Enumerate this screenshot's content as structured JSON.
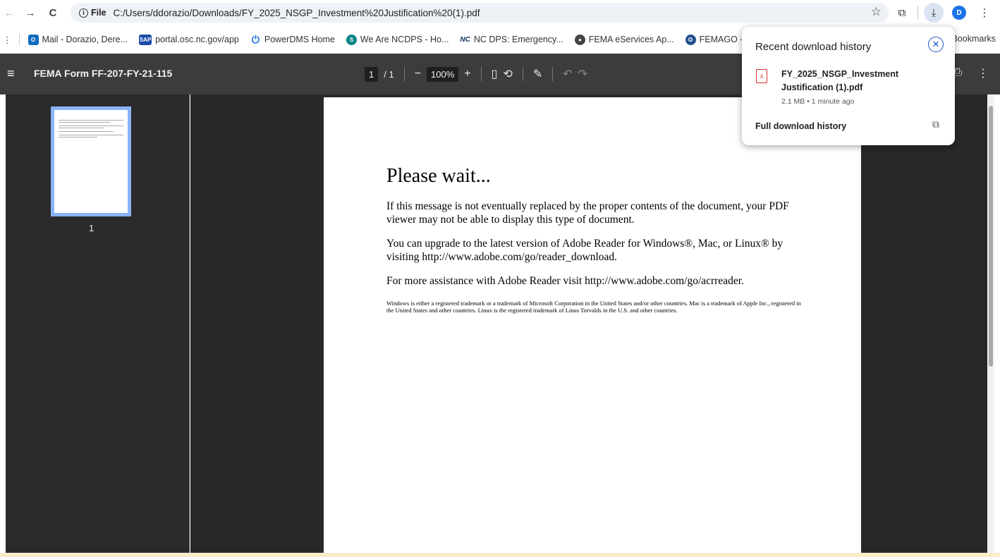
{
  "browser": {
    "nav": {
      "back": "←",
      "forward": "→",
      "reload": "C"
    },
    "chip_label": "File",
    "url": "C:/Users/ddorazio/Downloads/FY_2025_NSGP_Investment%20Justification%20(1).pdf",
    "avatar_letter": "D"
  },
  "bookmarks": {
    "items": [
      {
        "label": "Mail - Dorazio, Dere...",
        "icon": "outlook-icon",
        "color": "#0f6cbd"
      },
      {
        "label": "portal.osc.nc.gov/app",
        "icon": "sap-icon",
        "color": "#1a4aa8"
      },
      {
        "label": "PowerDMS Home",
        "icon": "power-icon",
        "color": "#1a73e8"
      },
      {
        "label": "We Are NCDPS - Ho...",
        "icon": "sharepoint-icon",
        "color": "#038387"
      },
      {
        "label": "NC DPS: Emergency...",
        "icon": "nc-icon",
        "color": "#0b2e59"
      },
      {
        "label": "FEMA eServices Ap...",
        "icon": "globe-icon",
        "color": "#444"
      },
      {
        "label": "FEMAGO - Home Pa...",
        "icon": "fema-seal-icon",
        "color": "#1f4e8c"
      }
    ],
    "all_bookmarks": "Bookmarks"
  },
  "pdf_toolbar": {
    "title": "FEMA Form FF-207-FY-21-115",
    "page_current": "1",
    "page_total": "/ 1",
    "zoom": "100%"
  },
  "sidebar": {
    "thumb_page": "1"
  },
  "document": {
    "title": "Please wait...",
    "paragraph1": "If this message is not eventually replaced by the proper contents of the document, your PDF viewer may not be able to display this type of document.",
    "paragraph2": "You can upgrade to the latest version of Adobe Reader for Windows®, Mac, or Linux® by visiting  http://www.adobe.com/go/reader_download.",
    "paragraph3": "For more assistance with Adobe Reader visit  http://www.adobe.com/go/acrreader.",
    "footnote": "Windows is either a registered trademark or a trademark of Microsoft Corporation in the United States and/or other countries. Mac is a trademark of Apple Inc., registered in the United States and other countries. Linux is the registered trademark of Linus Torvalds in the U.S. and other countries."
  },
  "download_popup": {
    "title": "Recent download history",
    "file_name": "FY_2025_NSGP_Investment Justification (1).pdf",
    "meta": "2.1 MB • 1 minute ago",
    "full_history": "Full download history"
  }
}
